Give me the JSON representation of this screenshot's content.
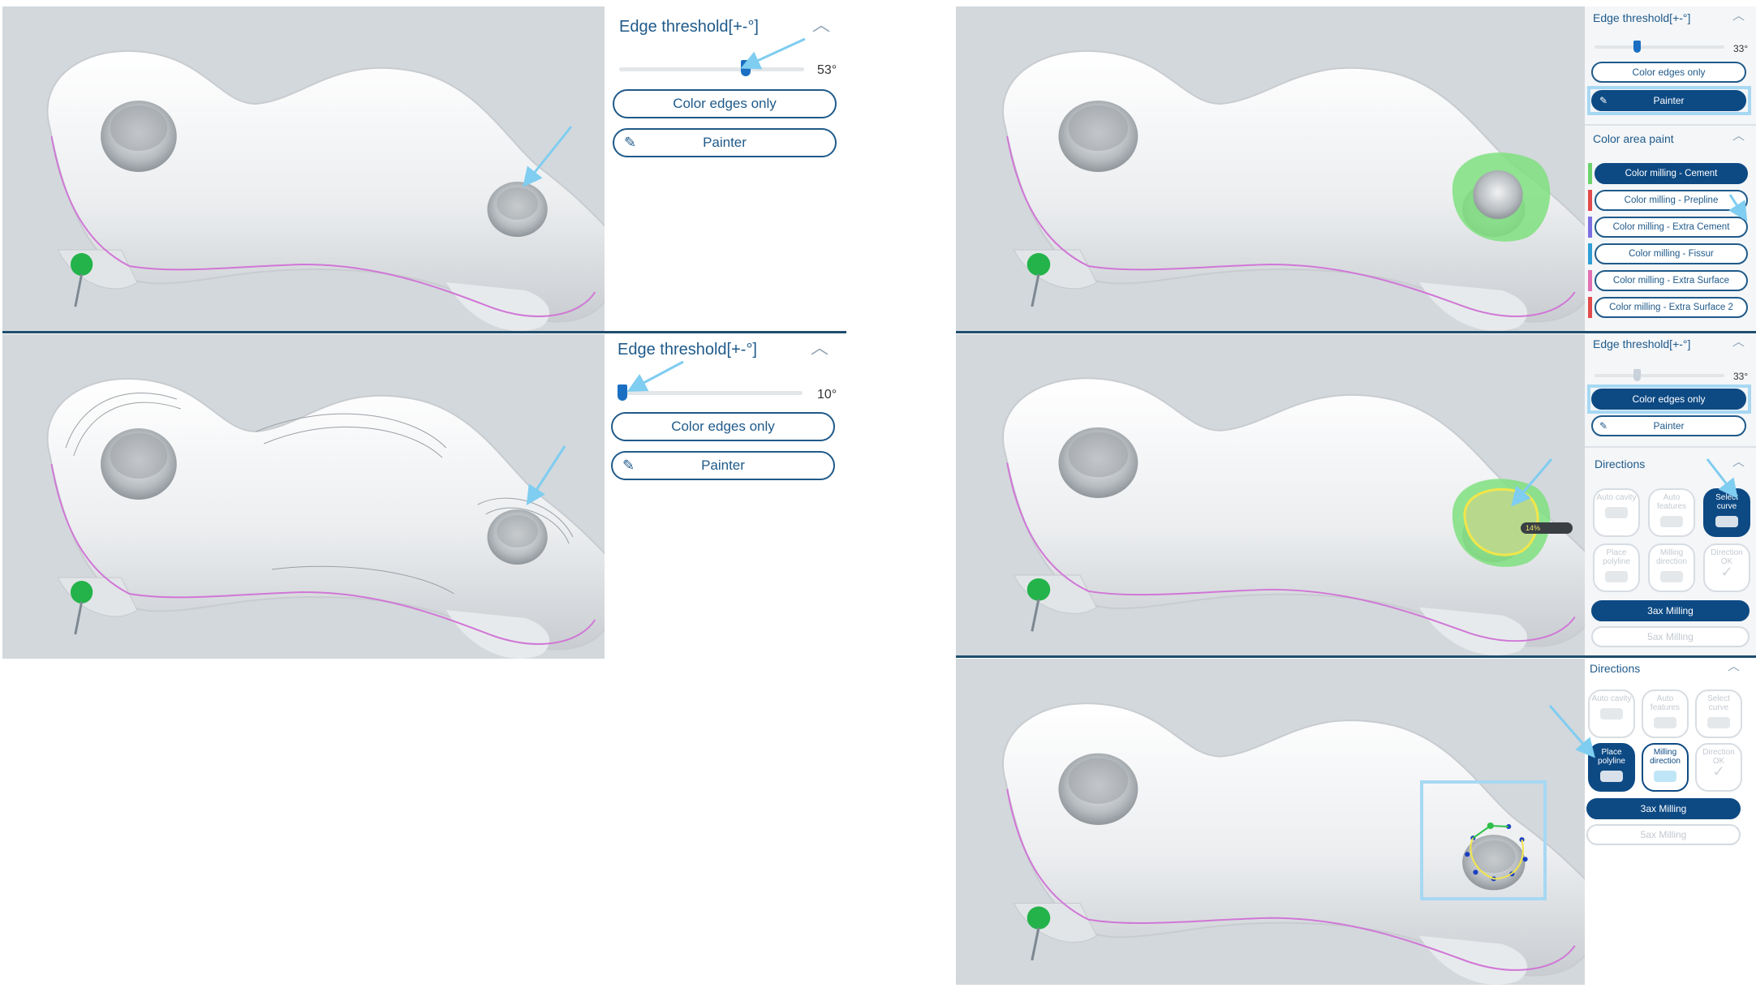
{
  "colors": {
    "accent": "#0d4a84",
    "highlight": "#a7d8f3",
    "arrow": "#7fcdf0",
    "paint_green": "#7fe07f"
  },
  "panel_tl": {
    "title": "Edge threshold[+-°]",
    "value": "53°",
    "slider_fraction": 0.68,
    "color_edges_label": "Color edges only",
    "painter_label": "Painter"
  },
  "panel_ml": {
    "title": "Edge threshold[+-°]",
    "value": "10°",
    "slider_fraction": 0.02,
    "color_edges_label": "Color edges only",
    "painter_label": "Painter"
  },
  "panel_tr": {
    "title": "Edge threshold[+-°]",
    "value": "33°",
    "slider_fraction": 0.33,
    "color_edges_label": "Color edges only",
    "painter_label": "Painter",
    "paint_title": "Color area paint",
    "paint_items": [
      {
        "label": "Color milling - Cement",
        "color": "#6fd36f"
      },
      {
        "label": "Color milling - Prepline",
        "color": "#e24b4b"
      },
      {
        "label": "Color milling - Extra Cement",
        "color": "#7b6fe0"
      },
      {
        "label": "Color milling - Fissur",
        "color": "#2f9fd6"
      },
      {
        "label": "Color milling - Extra Surface",
        "color": "#e26fb3"
      },
      {
        "label": "Color milling - Extra Surface 2",
        "color": "#e24b4b"
      }
    ]
  },
  "panel_mr": {
    "title": "Edge threshold[+-°]",
    "value": "33°",
    "slider_fraction": 0.33,
    "color_edges_label": "Color edges only",
    "painter_label": "Painter",
    "directions_title": "Directions",
    "tiles": [
      "Auto cavity",
      "Auto features",
      "Select curve",
      "Place polyline",
      "Milling direction",
      "Direction OK"
    ],
    "btn_3ax": "3ax Milling",
    "btn_5ax": "5ax Milling"
  },
  "panel_br": {
    "directions_title": "Directions",
    "tiles": [
      "Auto cavity",
      "Auto features",
      "Select curve",
      "Place polyline",
      "Milling direction",
      "Direction OK"
    ],
    "btn_3ax": "3ax Milling",
    "btn_5ax": "5ax Milling"
  },
  "viewport_chip": "14%"
}
